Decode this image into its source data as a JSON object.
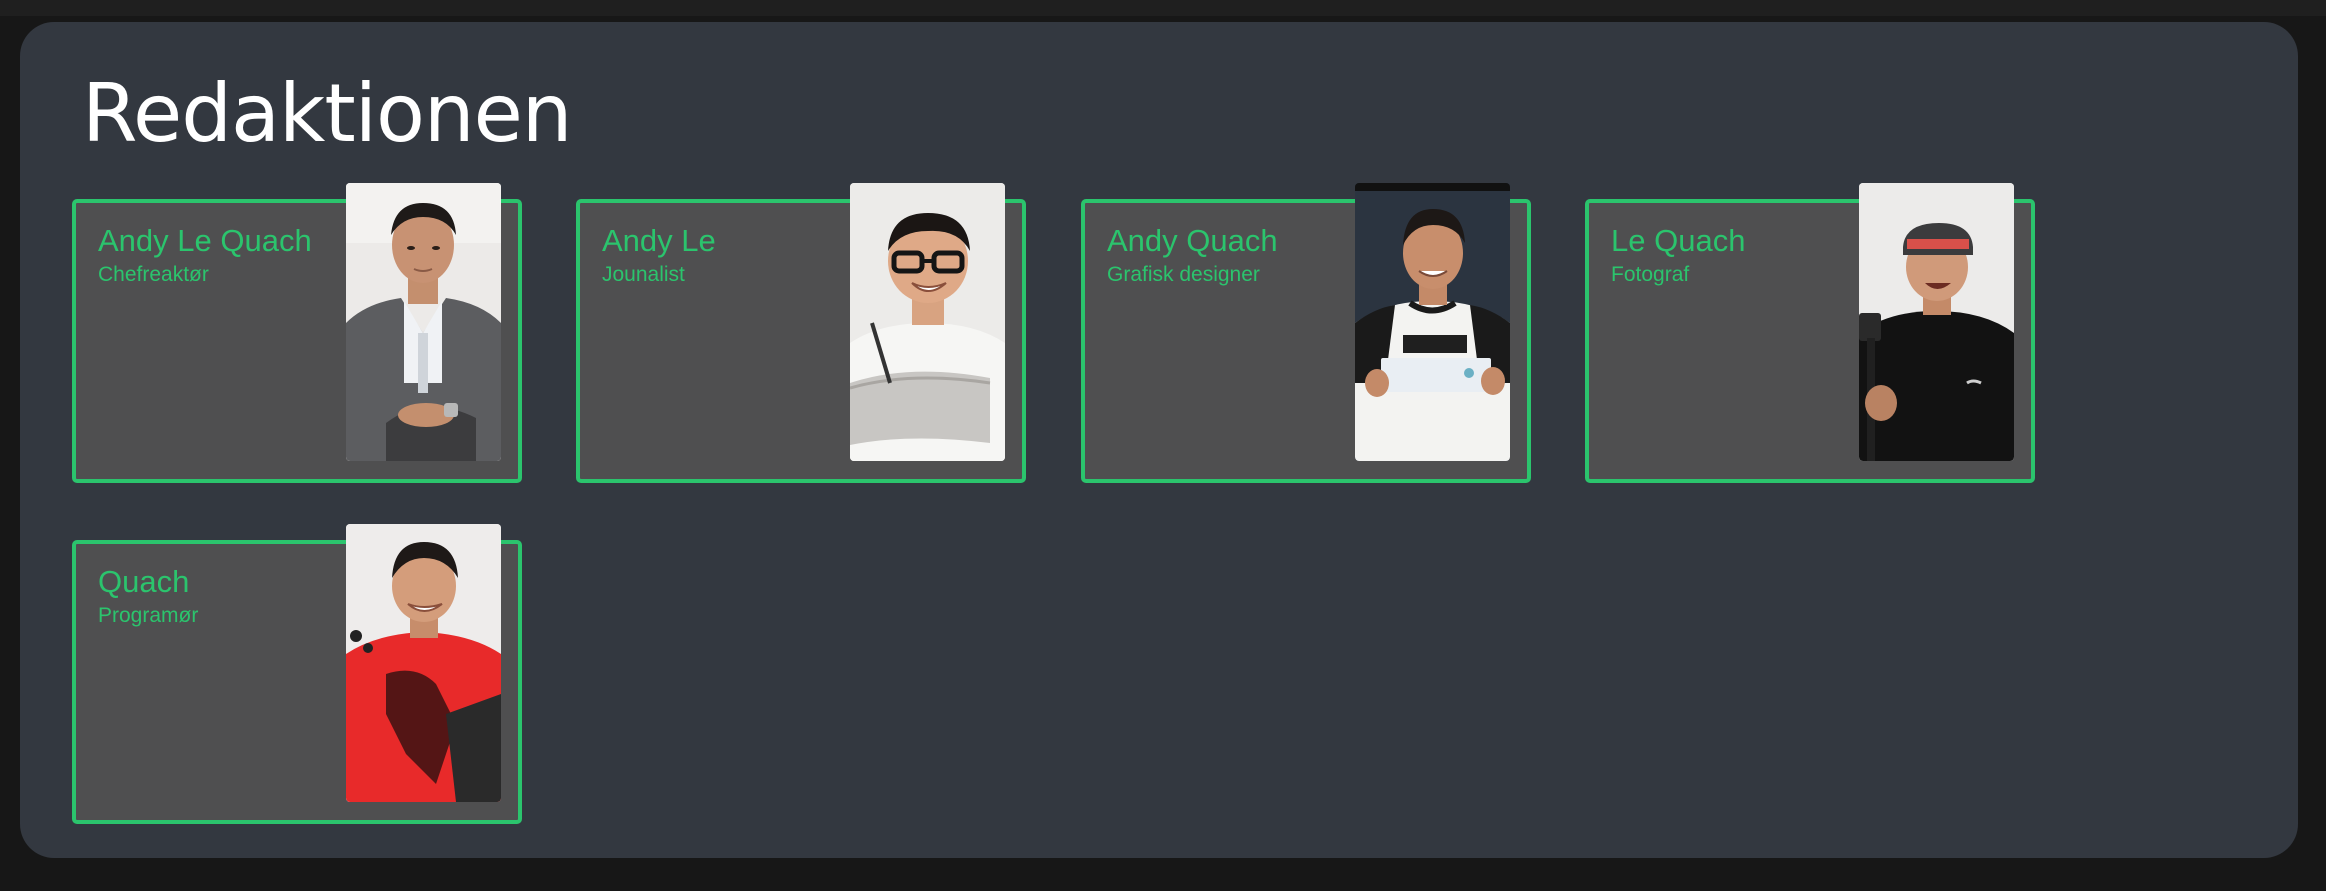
{
  "page": {
    "title": "Redaktionen"
  },
  "colors": {
    "accent": "#2bc46d",
    "panel": "#333840",
    "card": "#4f4f50",
    "background": "#171717"
  },
  "team": [
    {
      "name": "Andy Le Quach",
      "role": "Chefreaktør",
      "photo": "portrait-suit"
    },
    {
      "name": "Andy Le",
      "role": "Jounalist",
      "photo": "portrait-glasses"
    },
    {
      "name": "Andy Quach",
      "role": "Grafisk designer",
      "photo": "portrait-tshirt"
    },
    {
      "name": "Le Quach",
      "role": "Fotograf",
      "photo": "portrait-cap"
    },
    {
      "name": "Quach",
      "role": "Programør",
      "photo": "portrait-red-shirt"
    }
  ]
}
